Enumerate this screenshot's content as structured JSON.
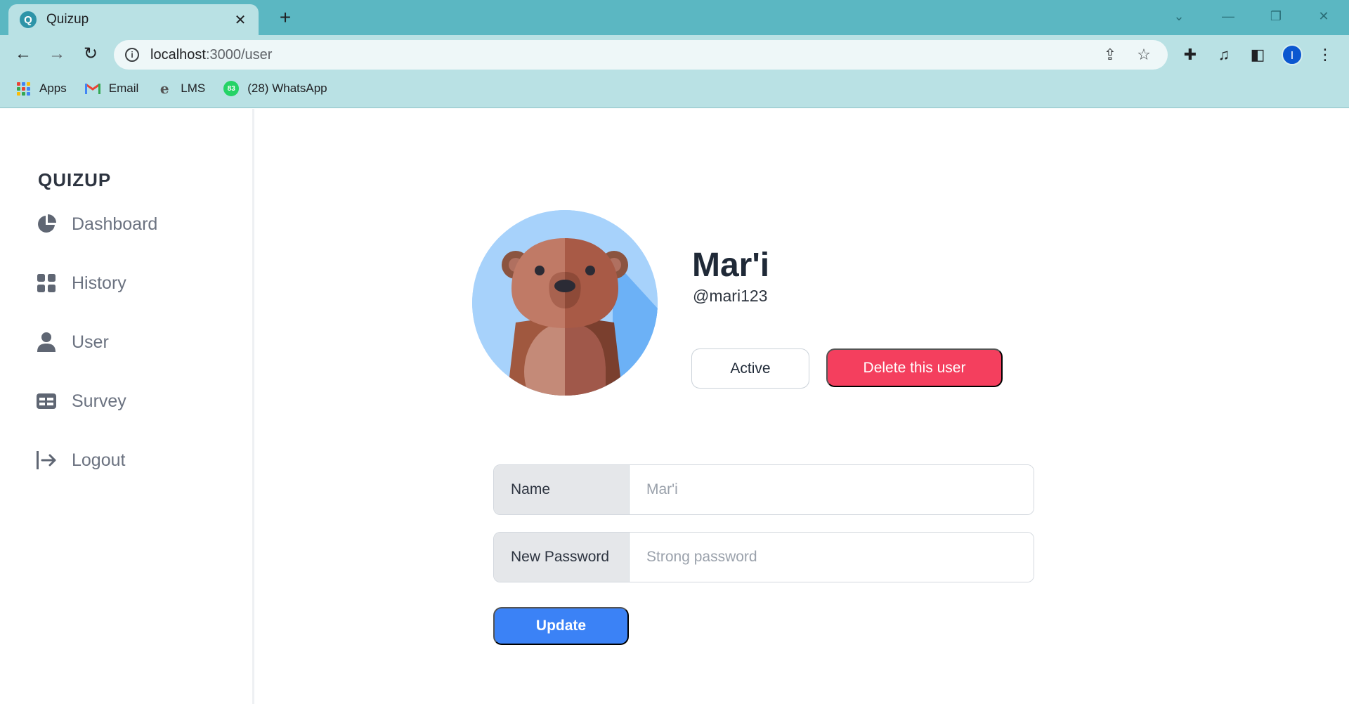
{
  "browser": {
    "tab_title": "Quizup",
    "tab_favicon": "Q",
    "url_host": "localhost",
    "url_path": ":3000/user",
    "profile_initial": "I",
    "bookmarks": [
      {
        "label": "Apps",
        "icon": "apps-grid-icon"
      },
      {
        "label": "Email",
        "icon": "gmail-icon"
      },
      {
        "label": "LMS",
        "icon": "lms-icon"
      },
      {
        "label": "(28) WhatsApp",
        "icon": "whatsapp-icon",
        "badge": "83"
      }
    ]
  },
  "sidebar": {
    "brand": "QUIZUP",
    "items": [
      {
        "label": "Dashboard",
        "icon": "pie-chart-icon"
      },
      {
        "label": "History",
        "icon": "grid-icon"
      },
      {
        "label": "User",
        "icon": "user-icon"
      },
      {
        "label": "Survey",
        "icon": "table-icon"
      },
      {
        "label": "Logout",
        "icon": "logout-icon"
      }
    ]
  },
  "profile": {
    "name": "Mar'i",
    "handle": "@mari123",
    "status_button": "Active",
    "delete_button": "Delete this user",
    "avatar": "bear-avatar"
  },
  "form": {
    "name_label": "Name",
    "name_placeholder": "Mar'i",
    "password_label": "New Password",
    "password_placeholder": "Strong password",
    "submit_label": "Update"
  },
  "colors": {
    "accent_blue": "#3b82f6",
    "danger": "#f43f5e",
    "chrome_tabstrip": "#5bb7c2",
    "chrome_toolbar": "#b9e1e4"
  }
}
